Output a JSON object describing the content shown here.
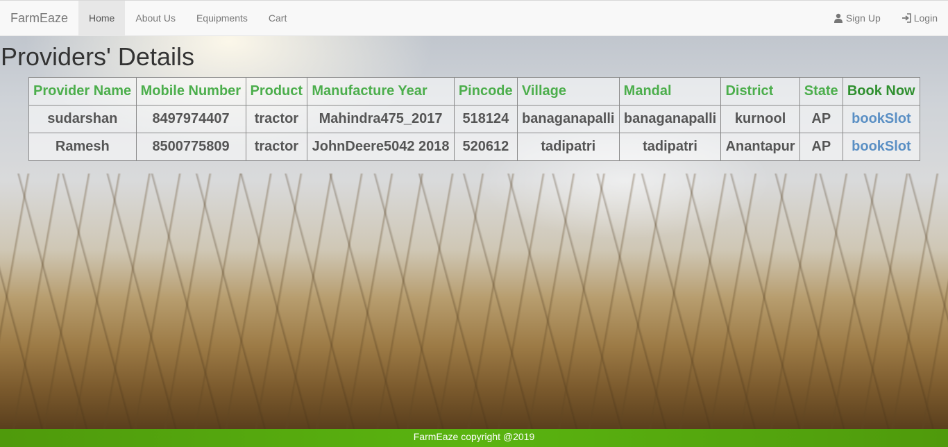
{
  "navbar": {
    "brand": "FarmEaze",
    "left_items": [
      {
        "label": "Home",
        "active": true
      },
      {
        "label": "About Us"
      },
      {
        "label": "Equipments"
      },
      {
        "label": "Cart"
      }
    ],
    "right_items": [
      {
        "label": "Sign Up",
        "icon": "user-icon"
      },
      {
        "label": "Login",
        "icon": "login-icon"
      }
    ]
  },
  "page": {
    "title": "Providers' Details"
  },
  "table": {
    "headers": [
      "Provider Name",
      "Mobile Number",
      "Product",
      "Manufacture Year",
      "Pincode",
      "Village",
      "Mandal",
      "District",
      "State",
      "Book Now"
    ],
    "rows": [
      [
        "sudarshan",
        "8497974407",
        "tractor",
        "Mahindra475_2017",
        "518124",
        "banaganapalli",
        "banaganapalli",
        "kurnool",
        "AP",
        "bookSlot"
      ],
      [
        "Ramesh",
        "8500775809",
        "tractor",
        "JohnDeere5042 2018",
        "520612",
        "tadipatri",
        "tadipatri",
        "Anantapur",
        "AP",
        "bookSlot"
      ]
    ]
  },
  "footer": {
    "text": "FarmEaze copyright @2019"
  },
  "colors": {
    "header_text": "#4cae4c",
    "link": "#5a8fc4",
    "footer_bg": "#5ab410"
  }
}
